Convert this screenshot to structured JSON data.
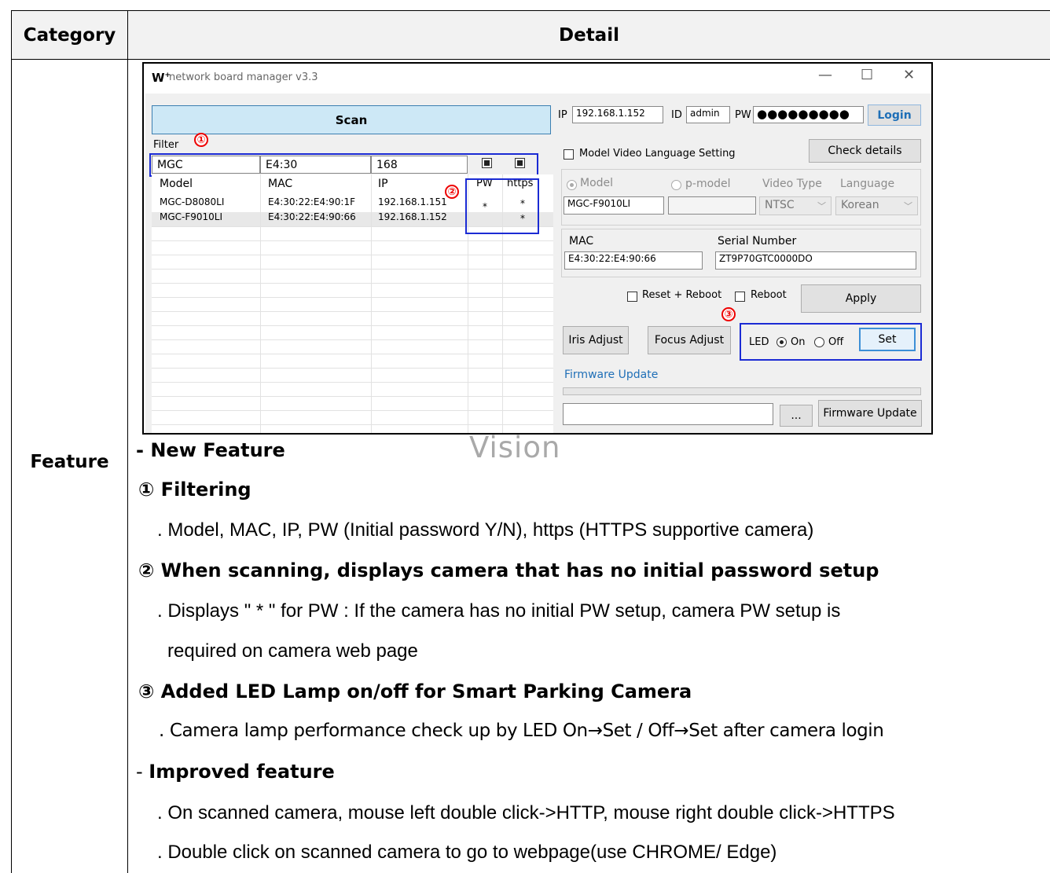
{
  "table": {
    "header_category": "Category",
    "header_detail": "Detail",
    "category_value": "Feature"
  },
  "app": {
    "logo": "W",
    "title": "network board manager v3.3",
    "window_controls": {
      "minimize": "—",
      "maximize": "☐",
      "close": "✕"
    },
    "scan_label": "Scan",
    "filter_label": "Filter",
    "filter_values": {
      "model": "MGC",
      "mac": "E4:30",
      "ip": "168"
    },
    "grid_headers": [
      "Model",
      "MAC",
      "IP",
      "PW",
      "https"
    ],
    "rows": [
      {
        "model": "MGC-D8080LI",
        "mac": "E4:30:22:E4:90:1F",
        "ip": "192.168.1.151",
        "pw": "*",
        "https": "*"
      },
      {
        "model": "MGC-F9010LI",
        "mac": "E4:30:22:E4:90:66",
        "ip": "192.168.1.152",
        "pw": "",
        "https": "*"
      }
    ],
    "login": {
      "ip_label": "IP",
      "ip_value": "192.168.1.152",
      "id_label": "ID",
      "id_value": "admin",
      "pw_label": "PW",
      "pw_value": "●●●●●●●●●",
      "login_button": "Login"
    },
    "model_video_lang_setting": "Model Video Language Setting",
    "check_details": "Check details",
    "model_radio": "Model",
    "pmodel_radio": "p-model",
    "video_type_label": "Video Type",
    "language_label": "Language",
    "model_value": "MGC-F9010LI",
    "video_type_value": "NTSC",
    "language_value": "Korean",
    "mac_label": "MAC",
    "mac_value": "E4:30:22:E4:90:66",
    "serial_label": "Serial Number",
    "serial_value": "ZT9P70GTC0000DO",
    "reset_reboot": "Reset + Reboot",
    "reboot": "Reboot",
    "apply": "Apply",
    "iris_adjust": "Iris Adjust",
    "focus_adjust": "Focus Adjust",
    "led_label": "LED",
    "led_on": "On",
    "led_off": "Off",
    "set": "Set",
    "firmware_link": "Firmware Update",
    "browse": "...",
    "firmware_button": "Firmware Update",
    "markers": [
      "①",
      "②",
      "③"
    ]
  },
  "watermark": "Vision",
  "detail": {
    "new_feature_prefix": "- ",
    "new_feature": "New Feature",
    "item1_title": "① Filtering",
    "item1_text": ". Model, MAC, IP, PW (Initial password Y/N), https (HTTPS supportive camera)",
    "item2_title": "② When scanning, displays camera that has no initial password setup",
    "item2_text_1": ". Displays \" * \" for PW :  If the camera has no initial PW setup, camera PW setup is",
    "item2_text_2": "required on camera web page",
    "item3_title": "③ Added LED Lamp on/off for Smart Parking Camera",
    "item3_text": ". Camera lamp performance check up by LED On→Set / Off→Set after camera login",
    "improved_prefix": "- ",
    "improved": "Improved feature",
    "improved_1": ". On scanned camera, mouse left double click->HTTP, mouse right double click->HTTPS",
    "improved_2": ". Double click on scanned camera to go to webpage(use CHROME/ Edge)"
  }
}
